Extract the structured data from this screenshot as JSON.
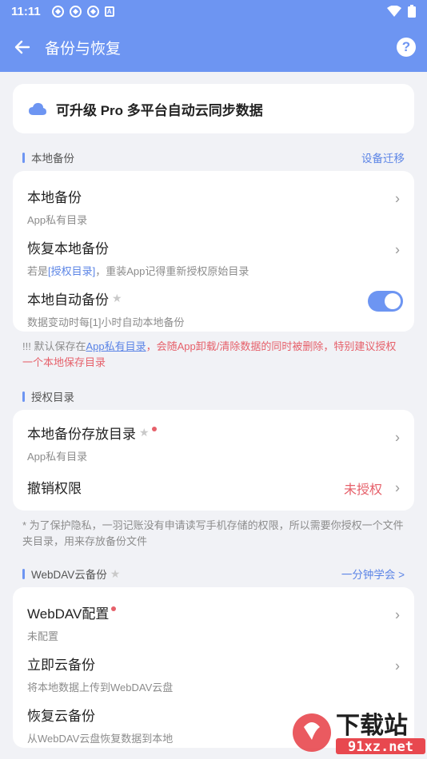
{
  "status": {
    "time": "11:11",
    "notif_badge": "A"
  },
  "appbar": {
    "title": "备份与恢复",
    "help": "?"
  },
  "pro": {
    "text": "可升级 Pro 多平台自动云同步数据"
  },
  "local": {
    "header": "本地备份",
    "link": "设备迁移",
    "rows": [
      {
        "title": "本地备份",
        "sub": "App私有目录"
      },
      {
        "title": "恢复本地备份",
        "sub_prefix": "若是",
        "sub_highlight": "[授权目录]",
        "sub_suffix": "，重装App记得重新授权原始目录"
      },
      {
        "title": "本地自动备份",
        "sub": "数据变动时每[1]小时自动本地备份",
        "toggle_on": true
      }
    ],
    "note_prefix": "!!! 默认保存在",
    "note_link": "App私有目录",
    "note_red": "，会随App卸载/清除数据的同时被删除，特别建议授权一个本地保存目录"
  },
  "auth": {
    "header": "授权目录",
    "rows": [
      {
        "title": "本地备份存放目录",
        "sub": "App私有目录"
      },
      {
        "title": "撤销权限",
        "value": "未授权"
      }
    ],
    "note": "* 为了保护隐私，一羽记账没有申请读写手机存储的权限，所以需要你授权一个文件夹目录，用来存放备份文件"
  },
  "webdav": {
    "header": "WebDAV云备份",
    "link": "一分钟学会 >",
    "rows": [
      {
        "title": "WebDAV配置",
        "sub": "未配置"
      },
      {
        "title": "立即云备份",
        "sub": "将本地数据上传到WebDAV云盘"
      },
      {
        "title": "恢复云备份",
        "sub": "从WebDAV云盘恢复数据到本地"
      }
    ]
  },
  "watermark": {
    "brand": "下载站",
    "site": "91xz.net"
  },
  "colors": {
    "accent": "#6d95f2",
    "link": "#5b84e6",
    "danger": "#e6606a",
    "background": "#f1f2f6"
  }
}
